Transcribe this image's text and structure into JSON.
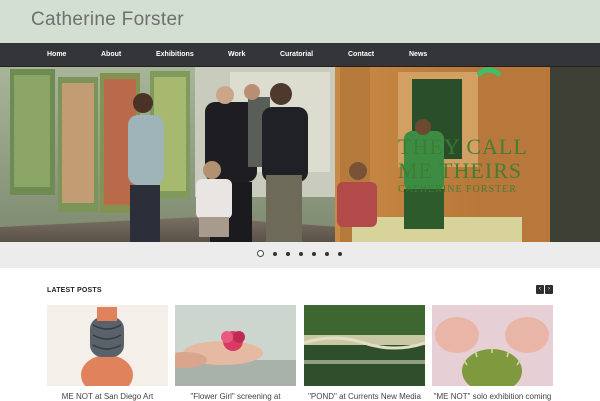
{
  "site": {
    "title": "Catherine Forster"
  },
  "nav": {
    "items": [
      {
        "label": "Home"
      },
      {
        "label": "About"
      },
      {
        "label": "Exhibitions"
      },
      {
        "label": "Work"
      },
      {
        "label": "Curatorial"
      },
      {
        "label": "Contact"
      },
      {
        "label": "News"
      }
    ]
  },
  "hero": {
    "sign_line1": "THEY CALL",
    "sign_line2": "ME THEIRS",
    "sign_line3": "CATHERINE FORSTER"
  },
  "slider": {
    "count": 7,
    "active": 1
  },
  "latest": {
    "title": "LATEST POSTS",
    "prev_icon": "‹",
    "next_icon": "›",
    "posts": [
      {
        "caption": "ME NOT at San Diego Art"
      },
      {
        "caption": "\"Flower Girl\" screening at"
      },
      {
        "caption": "\"POND\" at Currents New Media"
      },
      {
        "caption": "\"ME NOT\" solo exhibition coming"
      }
    ]
  },
  "colors": {
    "header_bg": "#d3dfd2",
    "nav_bg": "#333538",
    "sign_text": "#3c7d35"
  }
}
